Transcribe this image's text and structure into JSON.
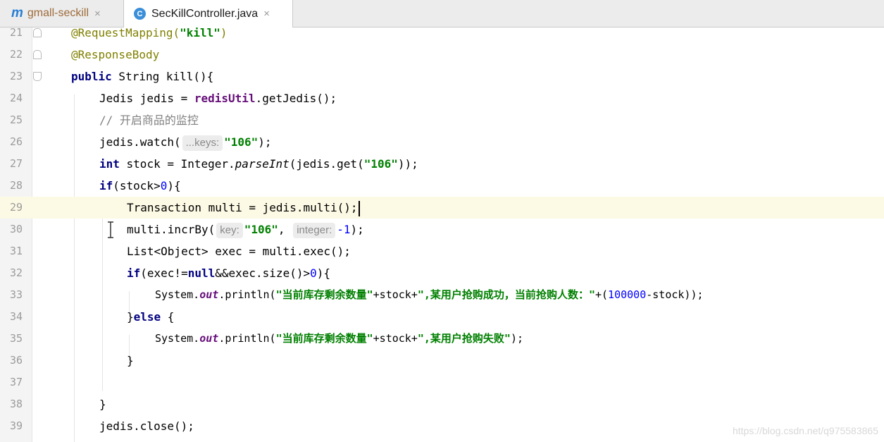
{
  "tabs": [
    {
      "icon": "m",
      "label": "gmall-seckill",
      "close": "×"
    },
    {
      "icon": "C",
      "label": "SecKillController.java",
      "close": "×"
    }
  ],
  "editor": {
    "line_numbers": [
      "21",
      "22",
      "23",
      "24",
      "25",
      "26",
      "27",
      "28",
      "29",
      "30",
      "31",
      "32",
      "33",
      "34",
      "35",
      "36",
      "37",
      "38",
      "39"
    ],
    "l21_ann": "@RequestMapping(",
    "l21_str": "\"kill\"",
    "l21_close": ")",
    "l22_ann": "@ResponseBody",
    "l23_kw": "public",
    "l23_rest": " String kill(){",
    "l24_a": "Jedis jedis = ",
    "l24_field": "redisUtil",
    "l24_b": ".getJedis();",
    "l25_comment": "// 开启商品的监控",
    "l26_a": "jedis.watch(",
    "l26_hint": "...keys:",
    "l26_str": "\"106\"",
    "l26_b": ");",
    "l27_kw": "int",
    "l27_a": " stock = Integer.",
    "l27_method": "parseInt",
    "l27_b": "(jedis.get(",
    "l27_str": "\"106\"",
    "l27_c": "));",
    "l28_kw": "if",
    "l28_a": "(stock>",
    "l28_num": "0",
    "l28_b": "){",
    "l29_a": "Transaction multi = jedis.multi();",
    "l30_a": "multi.incrBy(",
    "l30_hint1": "key:",
    "l30_str": "\"106\"",
    "l30_b": ",",
    "l30_hint2": "integer:",
    "l30_num": "-1",
    "l30_c": ");",
    "l31_a": "List<Object> exec = multi.exec();",
    "l32_kw": "if",
    "l32_a": "(exec!=",
    "l32_kw2": "null",
    "l32_b": "&&exec.size()>",
    "l32_num": "0",
    "l32_c": "){",
    "l33_a": "System.",
    "l33_out": "out",
    "l33_b": ".println(",
    "l33_str1": "\"当前库存剩余数量\"",
    "l33_c": "+stock+",
    "l33_str2": "\",某用户抢购成功，当前抢购人数：\"",
    "l33_d": "+(",
    "l33_num": "100000",
    "l33_e": "-stock));",
    "l34_a": "}",
    "l34_kw": "else",
    "l34_b": " {",
    "l35_a": "System.",
    "l35_out": "out",
    "l35_b": ".println(",
    "l35_str1": "\"当前库存剩余数量\"",
    "l35_c": "+stock+",
    "l35_str2": "\",某用户抢购失败\"",
    "l35_d": ");",
    "l36_a": "}",
    "l38_a": "}",
    "l39_a": "jedis.close();"
  },
  "watermark": "https://blog.csdn.net/q975583865",
  "colors": {
    "keyword": "#000080",
    "string": "#008000",
    "annotation": "#808000",
    "comment": "#808080",
    "field": "#660e7a",
    "number": "#0000ff",
    "current_line": "#fcf9e4"
  }
}
